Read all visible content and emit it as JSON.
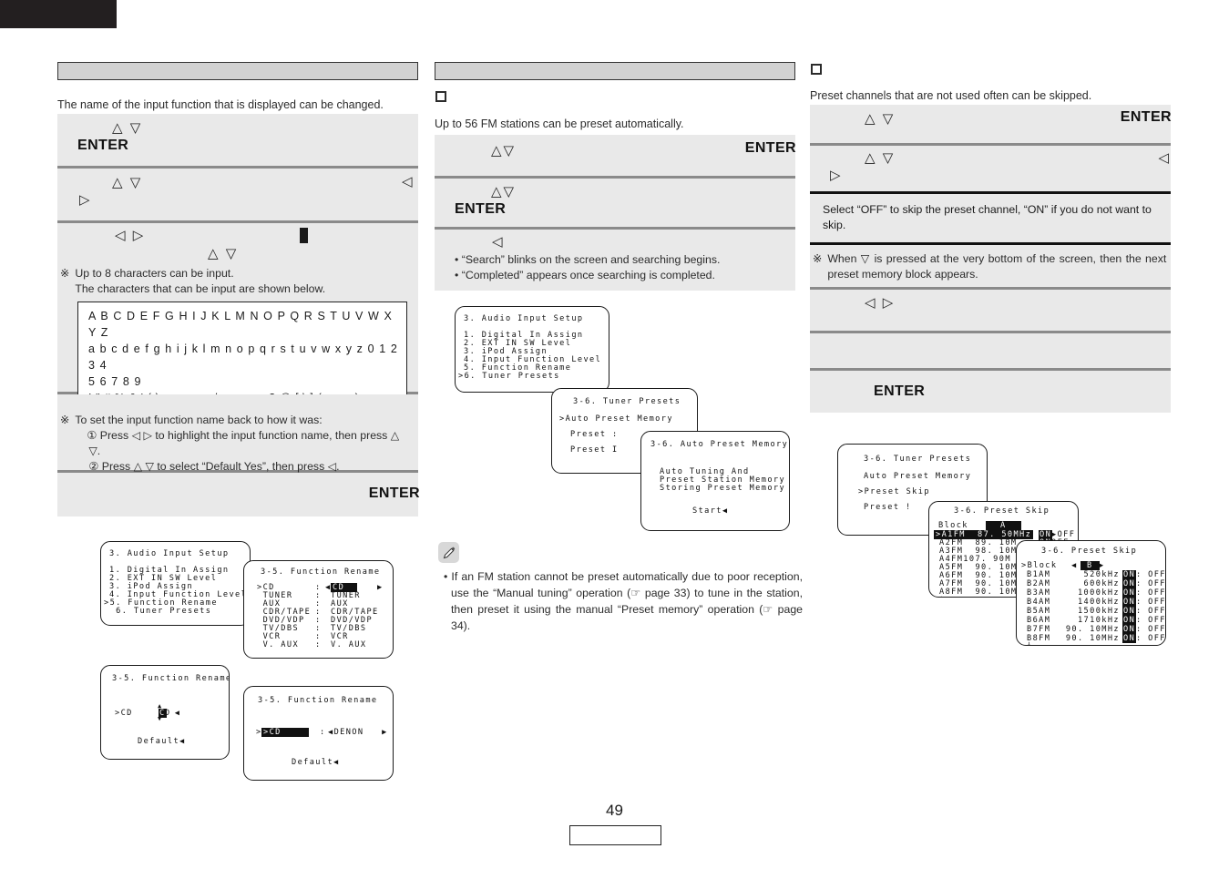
{
  "page": {
    "number": "49"
  },
  "left": {
    "heading": "",
    "intro": "The name of the input function that is displayed can be changed.",
    "steps": [
      {
        "arrows": "△ ▽",
        "enter": "ENTER"
      },
      {
        "arrows_top": "△ ▽",
        "arrow_right": "◁",
        "arrow_left": "▷"
      },
      {
        "arrows_lr": "◁ ▷",
        "arrows_ud": "△ ▽",
        "cursor": "block-cursor"
      }
    ],
    "note1": {
      "mark": "※",
      "line1": "Up to 8 characters can be input.",
      "line2": "The characters that can be input are shown below."
    },
    "charset": [
      "A B C D E F G H I J K L M N O P Q R S T U V W X Y Z",
      "a b c d e f g h i j k l m n o p q r s t u v w x y z 0 1 2 3 4",
      "5 6 7 8 9",
      "! \" # % & ' ( ) ∗ + , − . / : ; < = > ? @ [ \\ ] (space)"
    ],
    "note2": {
      "mark": "※",
      "intro": "To set the input function name back to how it was:",
      "items": [
        "① Press ◁ ▷ to highlight the input function name, then press △ ▽.",
        "② Press △ ▽ to select “Default Yes”, then press ◁."
      ]
    },
    "final_enter": "ENTER",
    "osd": {
      "menu": {
        "title": "3. Audio Input Setup",
        "rows": [
          "1. Digital In Assign",
          "2. EXT IN SW Level",
          "3. iPod Assign",
          "4. Input Function Level",
          ">5. Function Rename",
          "  6. Tuner Presets"
        ]
      },
      "rename_list": {
        "title": "3-5. Function Rename",
        "rows": [
          {
            "left": ">CD",
            "sep": ":",
            "right": "CD",
            "highlight": true,
            "arrows": true
          },
          {
            "left": " TUNER",
            "sep": ":",
            "right": "TUNER",
            "highlight": false,
            "arrows": false
          },
          {
            "left": " AUX",
            "sep": ":",
            "right": "AUX",
            "highlight": false,
            "arrows": false
          },
          {
            "left": " CDR/TAPE",
            "sep": ":",
            "right": "CDR/TAPE",
            "highlight": false,
            "arrows": false
          },
          {
            "left": " DVD/VDP",
            "sep": ":",
            "right": "DVD/VDP",
            "highlight": false,
            "arrows": false
          },
          {
            "left": " TV/DBS",
            "sep": ":",
            "right": "TV/DBS",
            "highlight": false,
            "arrows": false
          },
          {
            "left": " VCR",
            "sep": ":",
            "right": "VCR",
            "highlight": false,
            "arrows": false
          },
          {
            "left": " V. AUX",
            "sep": ":",
            "right": "V. AUX",
            "highlight": false,
            "arrows": false
          }
        ]
      },
      "rename_char": {
        "title": "3-5. Function Rename",
        "row": ">CD         : ◀C D",
        "default": "Default◀"
      },
      "rename_denon": {
        "title": "3-5. Function Rename",
        "row_left": ">CD",
        "row_right": "◀DENON   ▶",
        "default": "Default◀"
      }
    }
  },
  "mid": {
    "heading": "",
    "intro": "Up to 56 FM stations can be preset automatically.",
    "steps": [
      {
        "arrows": "△▽",
        "enter": "ENTER"
      },
      {
        "arrows": "△▽",
        "enter": "ENTER"
      },
      {
        "arrow": "◁",
        "bullets": [
          "• “Search” blinks on the screen and searching begins.",
          "• “Completed” appears once searching is completed."
        ]
      }
    ],
    "osd": {
      "menu": {
        "title": "3. Audio Input Setup",
        "rows": [
          "1. Digital In Assign",
          "2. EXT IN SW Level",
          "3. iPod Assign",
          "4. Input Function Level",
          "5. Function Rename",
          ">6. Tuner Presets"
        ]
      },
      "tuner_presets": {
        "title": "3-6. Tuner Presets",
        "rows": [
          ">Auto Preset Memory",
          "Preset :",
          "Preset I"
        ]
      },
      "auto_preset": {
        "title": "3-6. Auto Preset Memory",
        "rows": [
          "Auto Tuning And",
          "Preset Station Memory",
          "Storing Preset Memory"
        ],
        "start": "Start◀"
      }
    },
    "note": {
      "icon": "pencil-icon",
      "text": "• If an FM station cannot be preset automatically due to poor reception, use the “Manual tuning” operation (☞ page 33) to tune in the station, then preset it using the manual “Preset memory” operation (☞ page 34)."
    }
  },
  "right": {
    "intro": "Preset channels that are not used often can be skipped.",
    "steps": [
      {
        "arrows": "△ ▽",
        "enter": "ENTER"
      },
      {
        "arrows_top": "△ ▽",
        "arrow_right": "◁",
        "arrow_left": "▷"
      }
    ],
    "callout": "Select “OFF” to skip the preset channel, “ON” if you do not want to skip.",
    "note": {
      "mark": "※",
      "text": "When ▽ is pressed at the very bottom of the screen, then the next preset memory block appears."
    },
    "step_lr": "◁ ▷",
    "final_enter": "ENTER",
    "osd": {
      "tuner_presets": {
        "title": "3-6. Tuner Presets",
        "rows": [
          "Auto Preset Memory",
          ">Preset Skip",
          "Preset !"
        ]
      },
      "skip_a": {
        "title": "3-6. Preset Skip",
        "block_label": "Block",
        "block": "A",
        "rows": [
          {
            "ch": ">A1FM",
            "freq": " 87. 50MHz",
            "on": "ON",
            "off": "▶OFF",
            "selected": true
          },
          {
            "ch": " A2FM",
            "freq": " 89. 10M",
            "on": "ON",
            "off": "OFF",
            "selected": false
          },
          {
            "ch": " A3FM",
            "freq": " 98. 10M",
            "on": "",
            "off": "",
            "selected": false
          },
          {
            "ch": " A4FM",
            "freq": "107. 90M",
            "on": "",
            "off": "",
            "selected": false
          },
          {
            "ch": " A5FM",
            "freq": " 90. 10M",
            "on": "",
            "off": "",
            "selected": false
          },
          {
            "ch": " A6FM",
            "freq": " 90. 10M",
            "on": "",
            "off": "",
            "selected": false
          },
          {
            "ch": " A7FM",
            "freq": " 90. 10M",
            "on": "",
            "off": "",
            "selected": false
          },
          {
            "ch": " A8FM",
            "freq": " 90. 10M",
            "on": "",
            "off": "",
            "selected": false
          }
        ]
      },
      "skip_b": {
        "title": "3-6. Preset Skip",
        "block_row": ">Block",
        "block": "B",
        "rows": [
          {
            "ch": "B1AM",
            "freq": "520kHz",
            "on": "ON",
            "off": ": OFF"
          },
          {
            "ch": "B2AM",
            "freq": "600kHz",
            "on": "ON",
            "off": ": OFF"
          },
          {
            "ch": "B3AM",
            "freq": "1000kHz",
            "on": "ON",
            "off": ": OFF"
          },
          {
            "ch": "B4AM",
            "freq": "1400kHz",
            "on": "ON",
            "off": ": OFF"
          },
          {
            "ch": "B5AM",
            "freq": "1500kHz",
            "on": "ON",
            "off": ": OFF"
          },
          {
            "ch": "B6AM",
            "freq": "1710kHz",
            "on": "ON",
            "off": ": OFF"
          },
          {
            "ch": "B7FM",
            "freq": "90. 10MHz",
            "on": "ON",
            "off": ": OFF"
          },
          {
            "ch": "B8FM",
            "freq": "90. 10MHz",
            "on": "ON",
            "off": ": OFF"
          }
        ]
      }
    }
  }
}
